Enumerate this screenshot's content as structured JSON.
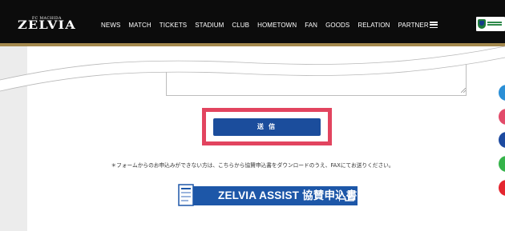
{
  "header": {
    "logo_small": "FC MACHIDA",
    "logo_main": "ZELVIA",
    "nav": [
      "NEWS",
      "MATCH",
      "TICKETS",
      "STADIUM",
      "CLUB",
      "HOMETOWN",
      "FAN",
      "GOODS",
      "RELATION",
      "PARTNER"
    ]
  },
  "form": {
    "submit_label": "送 信",
    "note": "＊フォームからのお申込みができない方は、こちらから協賛申込書をダウンロードのうえ、FAXにてお送りください。"
  },
  "assist": {
    "label": "ZELVIA ASSIST 協賛申込書",
    "icon": "download-icon"
  },
  "social": [
    "twitter-icon",
    "instagram-icon",
    "facebook-icon",
    "line-icon",
    "youtube-icon"
  ],
  "colors": {
    "header_bg": "#0c0c0c",
    "gold": "#a4894e",
    "brand_blue": "#1b4d9c",
    "highlight_red": "#e2445f"
  }
}
